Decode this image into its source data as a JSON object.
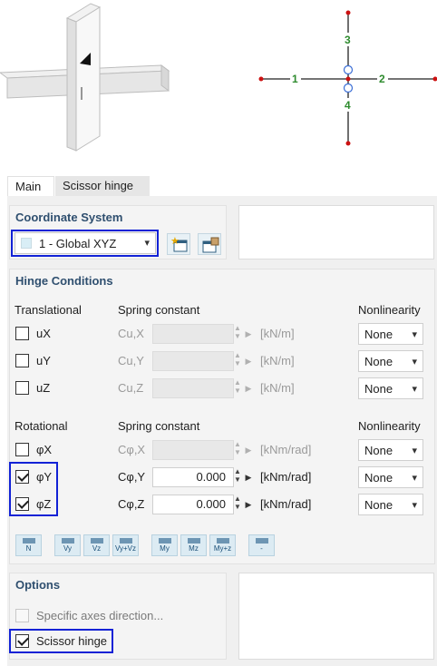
{
  "preview": {
    "axis_labels": {
      "left": "1",
      "right": "2",
      "top": "3",
      "bottom": "4"
    },
    "colors": {
      "axis_label": "#2e8b2e",
      "endpoint": "#cc1111",
      "node_circle": "#3b6ed6",
      "axis_line": "#222222"
    }
  },
  "tabs": [
    {
      "label": "Main",
      "active": true
    },
    {
      "label": "Scissor hinge",
      "active": false
    }
  ],
  "coordinate_system": {
    "title": "Coordinate System",
    "selected": "1 - Global XYZ",
    "new_icon": "new-coordinate-system-icon",
    "edit_icon": "edit-coordinate-system-icon"
  },
  "hinge_conditions": {
    "title": "Hinge Conditions",
    "translational": {
      "heading": "Translational",
      "spring_heading": "Spring constant",
      "nonlinearity_heading": "Nonlinearity",
      "rows": [
        {
          "label": "uX",
          "symbol": "Cu,X",
          "value": "",
          "unit": "[kN/m]",
          "checked": false,
          "nonlinearity": "None"
        },
        {
          "label": "uY",
          "symbol": "Cu,Y",
          "value": "",
          "unit": "[kN/m]",
          "checked": false,
          "nonlinearity": "None"
        },
        {
          "label": "uZ",
          "symbol": "Cu,Z",
          "value": "",
          "unit": "[kN/m]",
          "checked": false,
          "nonlinearity": "None"
        }
      ]
    },
    "rotational": {
      "heading": "Rotational",
      "spring_heading": "Spring constant",
      "nonlinearity_heading": "Nonlinearity",
      "rows": [
        {
          "label": "φX",
          "symbol": "Cφ,X",
          "value": "",
          "unit": "[kNm/rad]",
          "checked": false,
          "nonlinearity": "None"
        },
        {
          "label": "φY",
          "symbol": "Cφ,Y",
          "value": "0.000",
          "unit": "[kNm/rad]",
          "checked": true,
          "nonlinearity": "None"
        },
        {
          "label": "φZ",
          "symbol": "Cφ,Z",
          "value": "0.000",
          "unit": "[kNm/rad]",
          "checked": true,
          "nonlinearity": "None"
        }
      ]
    },
    "presets": [
      "N",
      "Vy",
      "Vz",
      "Vy+Vz",
      "My",
      "Mz",
      "My+z",
      "-"
    ]
  },
  "options": {
    "title": "Options",
    "specific_axes": {
      "label": "Specific axes direction...",
      "checked": false,
      "enabled": false
    },
    "scissor_hinge": {
      "label": "Scissor hinge",
      "checked": true
    }
  },
  "highlight_color": "#1222d6"
}
